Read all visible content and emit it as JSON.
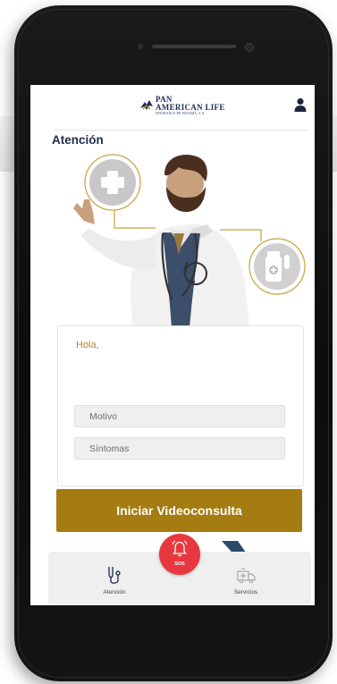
{
  "brand": {
    "logo_main": "AMERICAN LIFE",
    "logo_top": "PAN",
    "logo_sub": "INSURANCE DE PANAMÁ, S.A."
  },
  "page": {
    "title": "Atención"
  },
  "form": {
    "greeting": "Hola,",
    "motivo_placeholder": "Motivo",
    "sintomas_placeholder": "Síntomas"
  },
  "actions": {
    "start_video_consult": "Iniciar Videoconsulta"
  },
  "sos": {
    "label": "SOS"
  },
  "tabbar": {
    "tabs": [
      {
        "label": "Atención",
        "icon": "stethoscope-icon"
      },
      {
        "label": "Servicios",
        "icon": "ambulance-icon"
      }
    ]
  },
  "colors": {
    "accent_gold": "#a57c12",
    "greeting_gold": "#b08a24",
    "sos_red": "#e8383f",
    "brand_navy": "#1d2b5f",
    "title_navy": "#1f2d48"
  },
  "icons": {
    "profile": "user-icon",
    "illustration_left_badge": "medical-cross-icon",
    "illustration_right_badge": "medicine-bottle-icon",
    "sos": "alarm-bell-icon"
  }
}
